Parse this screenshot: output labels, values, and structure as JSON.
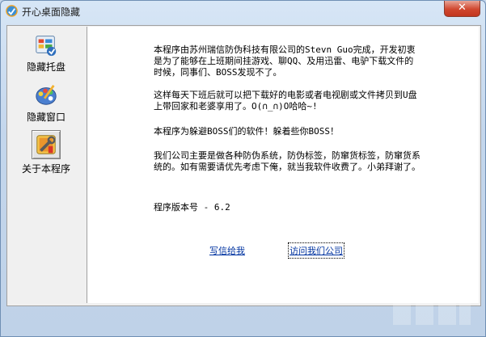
{
  "window": {
    "title": "开心桌面隐藏",
    "close_label": "✕"
  },
  "sidebar": {
    "items": [
      {
        "label": "隐藏托盘",
        "icon": "tray-hide-icon"
      },
      {
        "label": "隐藏窗口",
        "icon": "palette-icon"
      },
      {
        "label": "关于本程序",
        "icon": "tools-icon"
      }
    ],
    "selected_index": 2
  },
  "about": {
    "para1": "本程序由苏州瑞信防伪科技有限公司的Stevn Guo完成，开发初衷是为了能够在上班期间挂游戏、聊QQ、及用迅雷、电驴下载文件的时候，同事们、BOSS发现不了。",
    "para2": "这样每天下班后就可以把下载好的电影或者电视剧或文件拷贝到U盘上带回家和老婆享用了。O(∩_∩)O哈哈~!",
    "para3": "本程序为躲避BOSS们的软件！躲着些你BOSS！",
    "para4": "我们公司主要是做各种防伪系统，防伪标签，防窜货标签，防窜货系统的。如有需要请优先考虑下俺，就当我软件收费了。小弟拜谢了。",
    "version": "程序版本号 - 6.2",
    "link_mail": "写信给我",
    "link_visit": "访问我们公司"
  },
  "colors": {
    "link": "#0033a0",
    "close_button": "#d0472f"
  }
}
